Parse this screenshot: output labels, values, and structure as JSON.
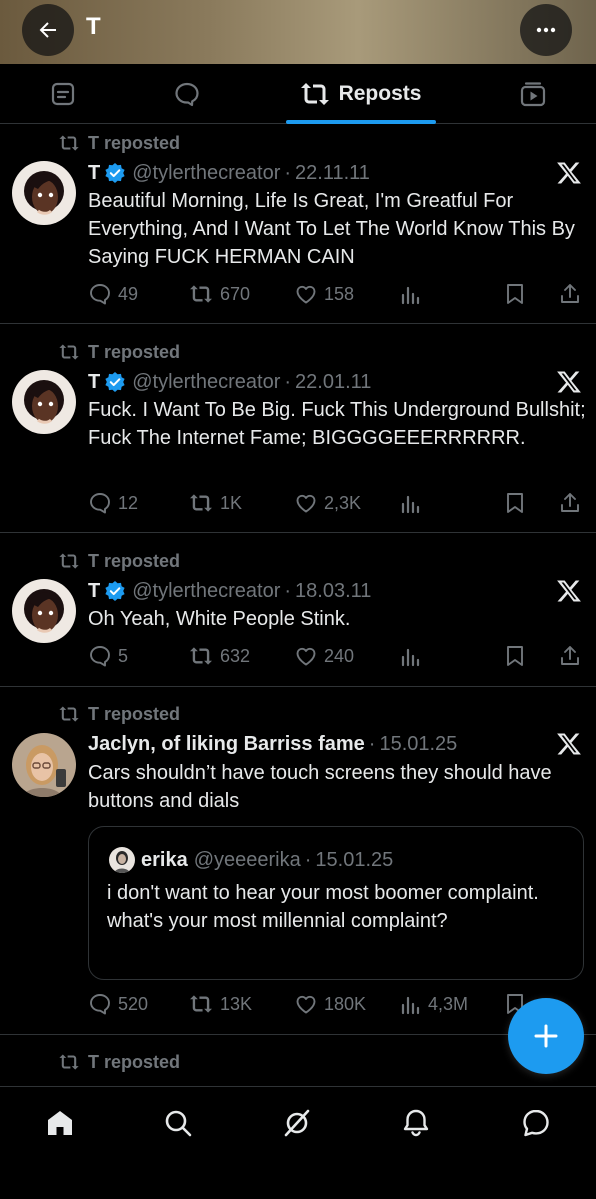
{
  "header": {
    "title": "T"
  },
  "tabs": {
    "active_label": "Reposts"
  },
  "repost_label": "T reposted",
  "posts": [
    {
      "name": "T",
      "handle": "@tylerthecreator",
      "date": "22.11.11",
      "text": "Beautiful Morning, Life Is Great, I'm Greatful For Everything, And I Want To Let The World Know This By Saying FUCK HERMAN CAIN",
      "replies": "49",
      "reposts": "670",
      "likes": "158",
      "views": ""
    },
    {
      "name": "T",
      "handle": "@tylerthecreator",
      "date": "22.01.11",
      "text": "Fuck. I Want To Be Big. Fuck This Underground Bullshit; Fuck The Internet Fame; BIGGGGEEERRRRRR.",
      "replies": "12",
      "reposts": "1K",
      "likes": "2,3K",
      "views": ""
    },
    {
      "name": "T",
      "handle": "@tylerthecreator",
      "date": "18.03.11",
      "text": "Oh Yeah, White People Stink.",
      "replies": "5",
      "reposts": "632",
      "likes": "240",
      "views": ""
    },
    {
      "name": "Jaclyn, of liking Barriss fame",
      "handle": "",
      "date": "15.01.25",
      "text": "Cars shouldn’t have touch screens they should have buttons and dials",
      "replies": "520",
      "reposts": "13K",
      "likes": "180K",
      "views": "4,3M",
      "quote": {
        "name": "erika",
        "handle": "@yeeeerika",
        "date": "15.01.25",
        "text": "i don't want to hear your most boomer complaint. what's your most millennial complaint?"
      }
    }
  ],
  "colors": {
    "accent": "#1d9bf0",
    "muted": "#71767b",
    "divider": "#2f3336",
    "background": "#000000"
  }
}
